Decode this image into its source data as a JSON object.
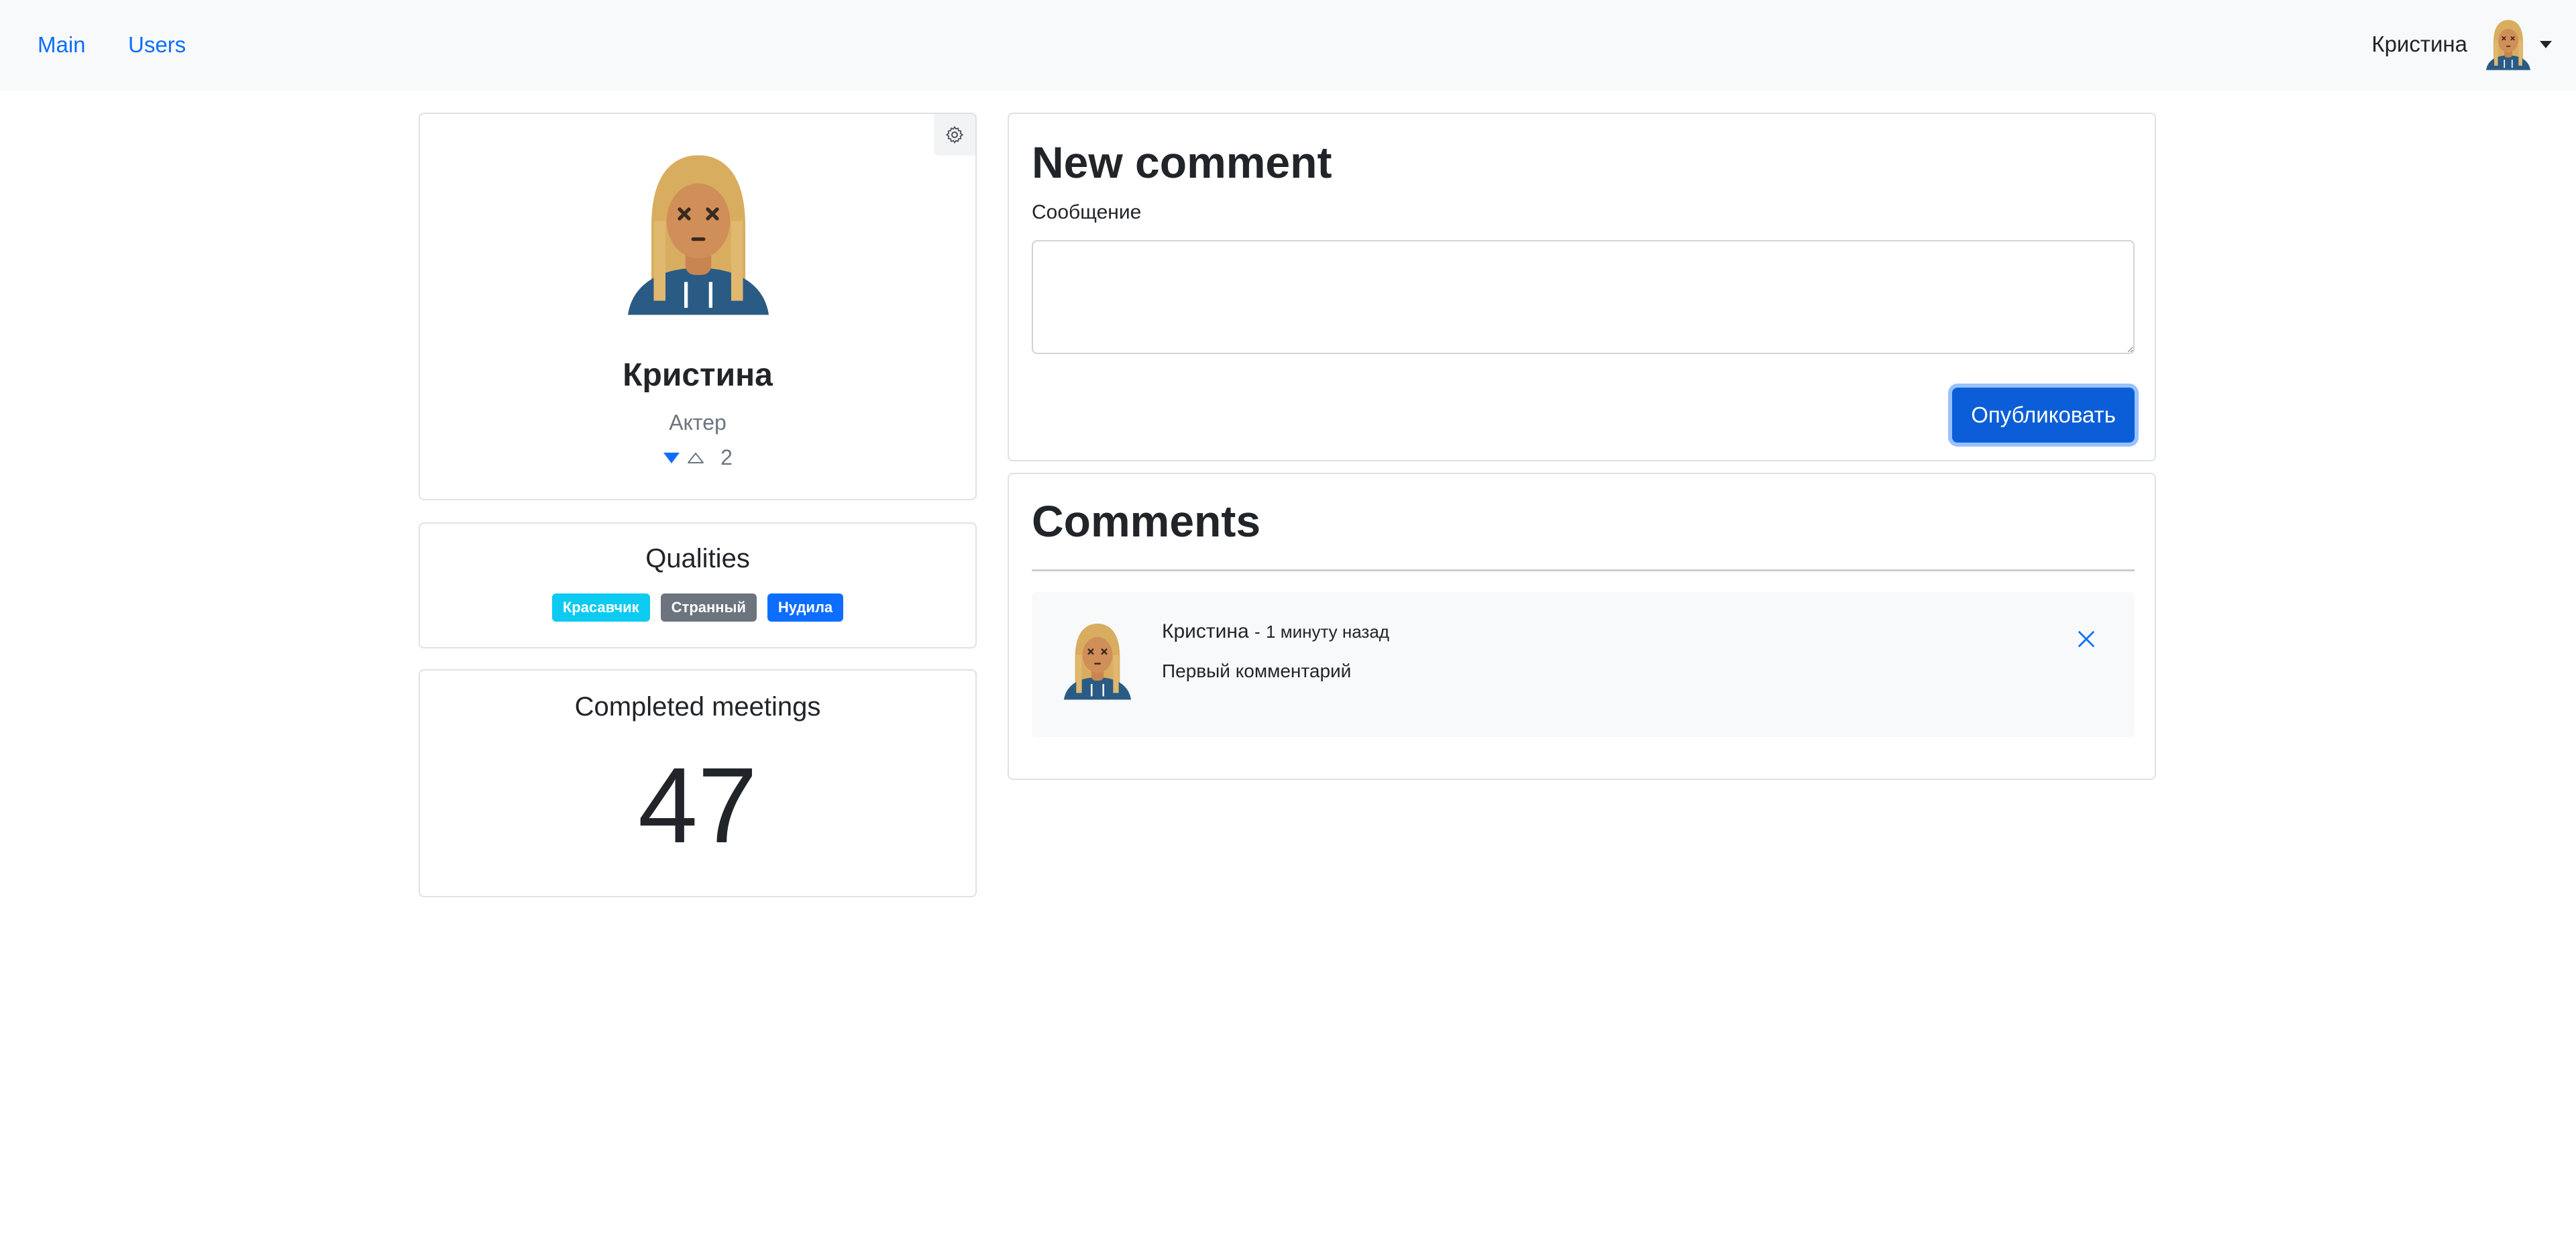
{
  "navbar": {
    "links": [
      {
        "label": "Main"
      },
      {
        "label": "Users"
      }
    ],
    "user": {
      "name": "Кристина",
      "avatar_icon": "avatar-female-blonde"
    },
    "link_color": "#0d6efd",
    "background": "#f8f9fa"
  },
  "profile": {
    "settings_icon": "gear-icon",
    "name": "Кристина",
    "role": "Актер",
    "rating": {
      "value": "2",
      "down_icon": "triangle-down-filled",
      "up_icon": "triangle-up-outline",
      "accent": "#0d6efd"
    }
  },
  "qualities": {
    "title": "Qualities",
    "badges": [
      {
        "label": "Красавчик",
        "color": "#0dcaf0"
      },
      {
        "label": "Странный",
        "color": "#6c757d"
      },
      {
        "label": "Нудила",
        "color": "#0d6efd"
      }
    ]
  },
  "meetings": {
    "title": "Completed meetings",
    "value": "47"
  },
  "new_comment": {
    "title": "New comment",
    "message_label": "Сообщение",
    "message_value": "",
    "submit_label": "Опубликовать",
    "submit_color": "#0b5ed7"
  },
  "comments": {
    "title": "Comments",
    "items": [
      {
        "author": "Кристина",
        "separator": "-",
        "time": "1 минуту назад",
        "text": "Первый комментарий",
        "delete_icon": "close-icon"
      }
    ]
  }
}
